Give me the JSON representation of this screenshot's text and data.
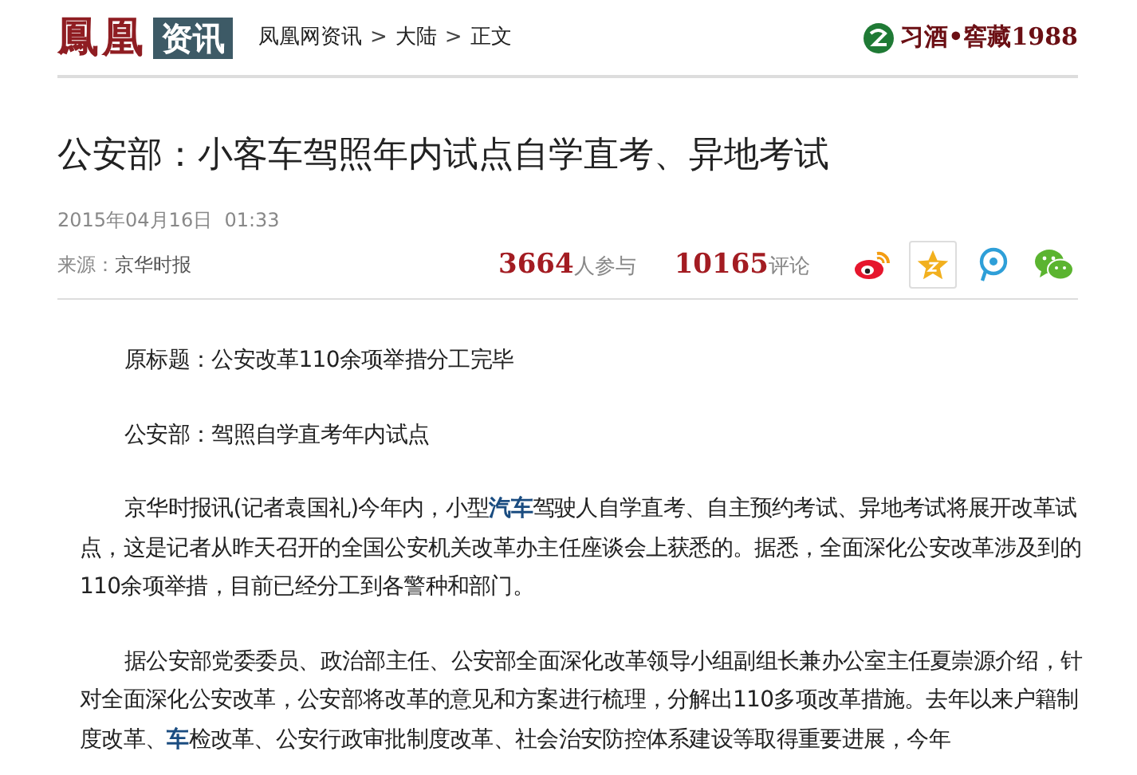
{
  "header": {
    "logo_main": "鳳凰",
    "logo_tag": "资讯",
    "breadcrumb": [
      "凤凰网资讯",
      "大陆",
      "正文"
    ],
    "breadcrumb_separator": ">",
    "ad_text": "习酒•窖藏1988"
  },
  "article": {
    "title": "公安部：小客车驾照年内试点自学直考、异地考试",
    "date": "2015年04月16日  01:33",
    "source_label": "来源：",
    "source": "京华时报",
    "stats": [
      {
        "count": "3664",
        "label": "人参与"
      },
      {
        "count": "10165",
        "label": "评论"
      }
    ],
    "share": [
      {
        "kind": "weibo",
        "selected": false
      },
      {
        "kind": "favorite",
        "selected": true
      },
      {
        "kind": "qq",
        "selected": false
      },
      {
        "kind": "wechat",
        "selected": false
      }
    ],
    "paragraphs": [
      [
        {
          "text": "原标题：公安改革110余项举措分工完毕",
          "kind": "text"
        }
      ],
      [
        {
          "text": "公安部：驾照自学直考年内试点",
          "kind": "text"
        }
      ],
      [
        {
          "text": "京华时报讯(记者袁国礼)今年内，小型",
          "kind": "text"
        },
        {
          "text": "汽车",
          "kind": "link"
        },
        {
          "text": "驾驶人自学直考、自主预约考试、异地考试将展开改革试点，这是记者从昨天召开的全国公安机关改革办主任座谈会上获悉的。据悉，全面深化公安改革涉及到的110余项举措，目前已经分工到各警种和部门。",
          "kind": "text"
        }
      ],
      [
        {
          "text": "据公安部党委委员、政治部主任、公安部全面深化改革领导小组副组长兼办公室主任夏崇源介绍，针对全面深化公安改革，公安部将改革的意见和方案进行梳理，分解出110多项改革措施。去年以来户籍制度改革、",
          "kind": "text"
        },
        {
          "text": "车",
          "kind": "link"
        },
        {
          "text": "检改革、公安行政审批制度改革、社会治安防控体系建设等取得重要进展，今年",
          "kind": "text"
        }
      ]
    ]
  }
}
